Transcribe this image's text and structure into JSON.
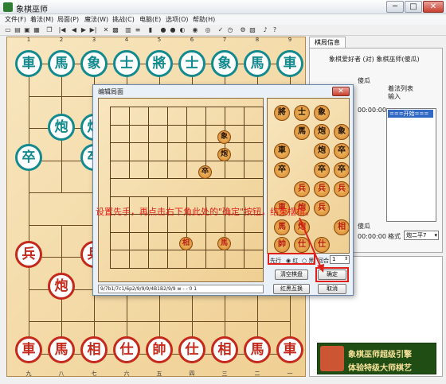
{
  "window": {
    "title": "象棋巫师",
    "minimize": "─",
    "maximize": "□",
    "close": "✕"
  },
  "menu": [
    "文件(F)",
    "着法(M)",
    "局面(P)",
    "魔法(W)",
    "挑战(C)",
    "电脑(E)",
    "选项(O)",
    "帮助(H)"
  ],
  "column_numbers_top": [
    "1",
    "2",
    "3",
    "4",
    "5",
    "6",
    "7",
    "8",
    "9"
  ],
  "column_numbers_bottom": [
    "九",
    "八",
    "七",
    "六",
    "五",
    "四",
    "三",
    "二",
    "一"
  ],
  "board": {
    "green_pieces": [
      "車",
      "馬",
      "象",
      "士",
      "將",
      "士",
      "象",
      "馬",
      "車",
      "炮",
      "炮",
      "卒",
      "卒"
    ],
    "red_pieces": [
      "兵",
      "兵",
      "炮",
      "車",
      "馬",
      "相",
      "仕",
      "帥",
      "仕",
      "相",
      "馬",
      "車"
    ]
  },
  "right_panel": {
    "tab": "棋局信息",
    "players": "象棋爱好者 (对) 象棋巫师(傻瓜)",
    "label_black_level": "傻瓜",
    "label_black_time": "00:00:00",
    "label_red_level": "傻瓜",
    "label_red_time": "00:00:00",
    "movelist_title": "着法列表",
    "input_label": "输入",
    "movelist_selected": "===开始===",
    "format_label": "格式",
    "format_value": "炮二平7"
  },
  "ad": {
    "line1": "象棋巫师超级引擎",
    "line2": "体验特级大师棋艺"
  },
  "dialog": {
    "title": "编辑局面",
    "close": "✕",
    "fen": "9/7b1/7c1/6p2/9/9/9/4B1B2/9/9 w - - 0 1",
    "mini_pieces": [
      "象",
      "炮",
      "卒",
      "相",
      "馬"
    ],
    "palette": [
      [
        "將",
        "士",
        "象"
      ],
      [
        "馬",
        "炮",
        "象"
      ],
      [
        "車",
        "炮",
        "卒"
      ],
      [
        "卒",
        "卒",
        "卒"
      ],
      [
        "兵",
        "兵",
        "兵"
      ],
      [
        "車",
        "炮",
        "兵"
      ],
      [
        "馬",
        "炮",
        "相"
      ],
      [
        "帥",
        "仕",
        "仕"
      ]
    ],
    "first_move_label": "先行",
    "red_label": "红",
    "black_label": "黑",
    "round_label": "回合",
    "round_value": "1",
    "clear_button": "清空棋盘",
    "swap_button": "红黑互换",
    "ok_button": "确定",
    "cancel_button": "取消"
  },
  "annotation": "设置先手，再点击右下角此处的\"确定\"按钮，结束摆棋。",
  "colors": {
    "green": "#128a8e",
    "red": "#c4291b",
    "highlight": "#e0201a"
  }
}
